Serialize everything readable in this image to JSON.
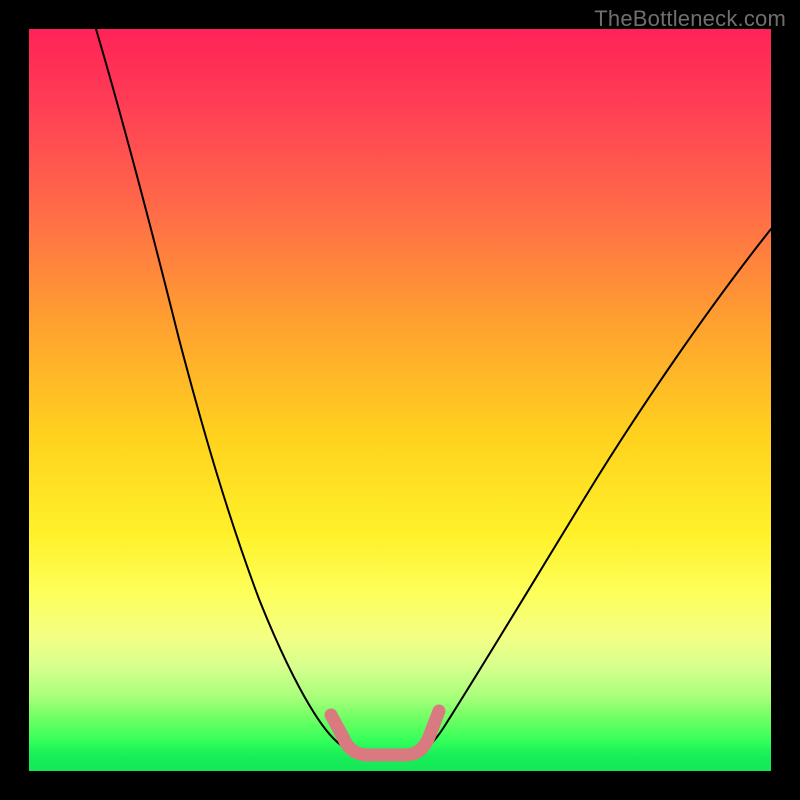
{
  "watermark": "TheBottleneck.com",
  "chart_data": {
    "type": "line",
    "title": "",
    "xlabel": "",
    "ylabel": "",
    "xlim": [
      0,
      100
    ],
    "ylim": [
      0,
      100
    ],
    "series": [
      {
        "name": "bottleneck-curve",
        "x": [
          9,
          12,
          15,
          18,
          22,
          26,
          30,
          34,
          37,
          40,
          42,
          44,
          46,
          48,
          50,
          52,
          55,
          60,
          66,
          72,
          78,
          84,
          90,
          96,
          100
        ],
        "values": [
          100,
          85,
          71,
          59,
          46,
          35,
          25,
          17,
          11,
          7,
          4,
          2.5,
          2,
          2,
          2,
          2.5,
          4,
          8,
          14,
          22,
          30,
          38,
          46,
          54,
          59
        ]
      }
    ],
    "annotations": [
      {
        "name": "optimal-zone-marker",
        "shape": "rounded-path",
        "color": "#d97a80",
        "points_x": [
          41.5,
          42.5,
          44,
          46,
          48,
          50,
          51.5,
          53,
          54
        ],
        "points_y": [
          7,
          4.5,
          3,
          2.5,
          2.5,
          2.5,
          3,
          5,
          8
        ]
      }
    ],
    "background": {
      "type": "vertical-gradient",
      "stops": [
        {
          "pos": 0,
          "color": "#ff2357"
        },
        {
          "pos": 25,
          "color": "#ff6d47"
        },
        {
          "pos": 55,
          "color": "#ffd21e"
        },
        {
          "pos": 80,
          "color": "#f3ff84"
        },
        {
          "pos": 95,
          "color": "#32ff5a"
        },
        {
          "pos": 100,
          "color": "#15e857"
        }
      ]
    }
  }
}
